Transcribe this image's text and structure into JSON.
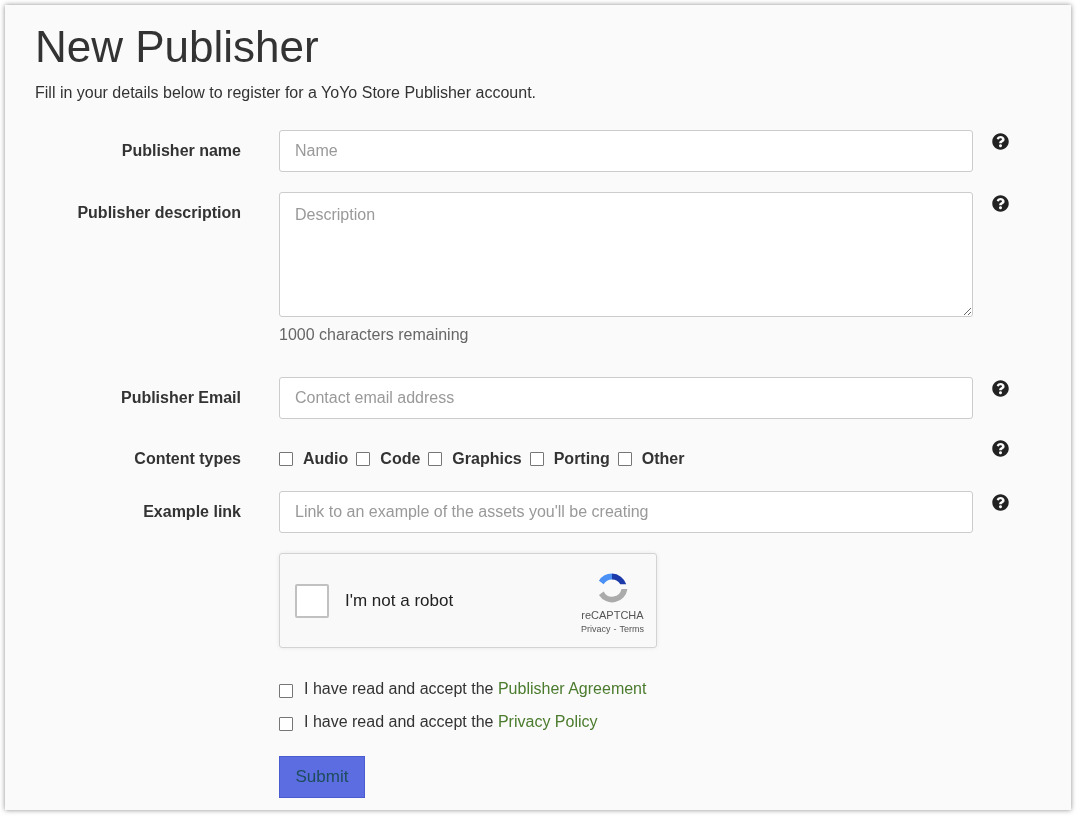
{
  "title": "New Publisher",
  "intro": "Fill in your details below to register for a YoYo Store Publisher account.",
  "fields": [
    {
      "kind": "text",
      "label": "Publisher name",
      "placeholder": "Name"
    },
    {
      "kind": "textarea",
      "label": "Publisher description",
      "placeholder": "Description",
      "note": "1000 characters remaining"
    },
    {
      "kind": "text",
      "label": "Publisher Email",
      "placeholder": "Contact email address"
    },
    {
      "kind": "checkboxes",
      "label": "Content types",
      "options": [
        {
          "label": "Audio",
          "checked": false
        },
        {
          "label": "Code",
          "checked": false
        },
        {
          "label": "Graphics",
          "checked": false
        },
        {
          "label": "Porting",
          "checked": false
        },
        {
          "label": "Other",
          "checked": false
        }
      ]
    },
    {
      "kind": "text",
      "label": "Example link",
      "placeholder": "Link to an example of the assets you'll be creating"
    }
  ],
  "captcha": {
    "label": "I'm not a robot",
    "checked": false,
    "brand": "reCAPTCHA",
    "privacy": "Privacy",
    "separator": "-",
    "terms": "Terms"
  },
  "agreements": [
    {
      "text": "I have read and accept the",
      "link": "Publisher Agreement",
      "checked": false
    },
    {
      "text": "I have read and accept the",
      "link": "Privacy Policy",
      "checked": false
    }
  ],
  "submit": "Submit"
}
